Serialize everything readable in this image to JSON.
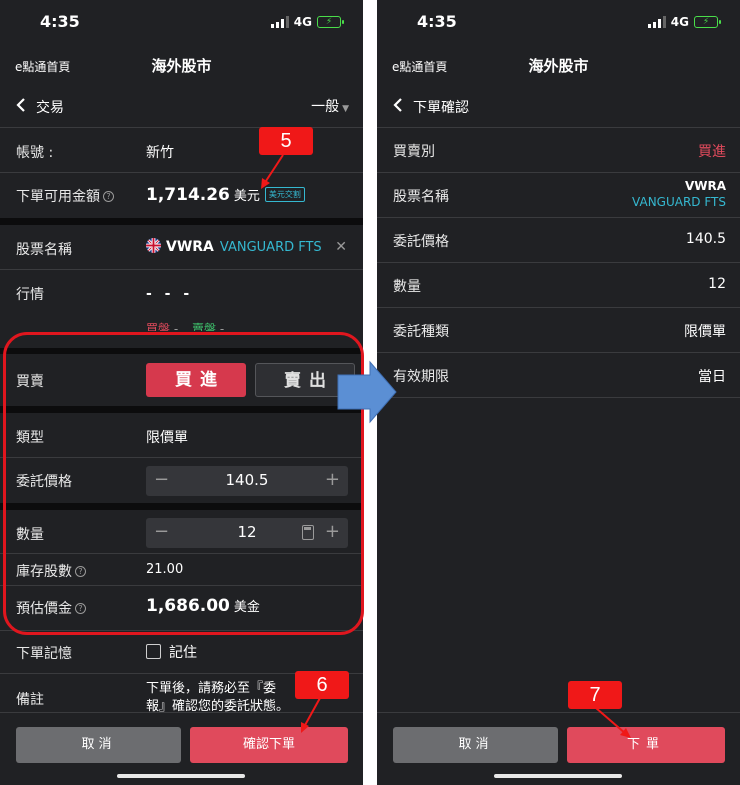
{
  "status_bar": {
    "time": "4:35",
    "network": "4G"
  },
  "app": {
    "home_link": "e點通首頁",
    "title": "海外股市"
  },
  "left": {
    "header": {
      "title": "交易",
      "mode": "一般"
    },
    "account": {
      "label": "帳號 :",
      "value": "新竹"
    },
    "available": {
      "label": "下單可用金額",
      "amount": "1,714.26",
      "unit": "美元",
      "tag": "美元交割"
    },
    "stock": {
      "label": "股票名稱",
      "code": "VWRA",
      "name": "VANGUARD FTS"
    },
    "quote": {
      "label": "行情",
      "value": "- - -",
      "bid": "買盤",
      "ask": "賣盤"
    },
    "side": {
      "label": "買賣",
      "buy": "買進",
      "sell": "賣出"
    },
    "order_type": {
      "label": "類型",
      "value": "限價單"
    },
    "price": {
      "label": "委託價格",
      "value": "140.5"
    },
    "quantity": {
      "label": "數量",
      "value": "12"
    },
    "holdings": {
      "label": "庫存股數",
      "value": "21.00"
    },
    "estimate": {
      "label": "預估價金",
      "amount": "1,686.00",
      "unit": "美金"
    },
    "memory": {
      "label": "下單記憶",
      "checkbox": "記住"
    },
    "note": {
      "label": "備註",
      "line1": "下單後，請務必至『委",
      "line2": "報』確認您的委託狀態。"
    },
    "buttons": {
      "cancel": "取消",
      "confirm": "確認下單"
    }
  },
  "right": {
    "header": {
      "title": "下單確認"
    },
    "rows": [
      {
        "label": "買賣別",
        "value": "買進"
      },
      {
        "label": "股票名稱",
        "value": "VWRA",
        "sub": "VANGUARD FTS"
      },
      {
        "label": "委託價格",
        "value": "140.5"
      },
      {
        "label": "數量",
        "value": "12"
      },
      {
        "label": "委託種類",
        "value": "限價單"
      },
      {
        "label": "有效期限",
        "value": "當日"
      }
    ],
    "buttons": {
      "cancel": "取消",
      "confirm": "下單"
    }
  },
  "annotations": {
    "step5": "5",
    "step6": "6",
    "step7": "7"
  },
  "colors": {
    "background": "#202124",
    "buy_red": "#d6394d",
    "accent_cyan": "#35b8d0",
    "annotation_red": "#f01818",
    "arrow_blue": "#5b8fd4"
  },
  "icons": [
    "back-chevron-icon",
    "caret-down-icon",
    "help-icon",
    "uk-flag-icon",
    "clear-icon",
    "minus-icon",
    "plus-icon",
    "calculator-icon",
    "checkbox-icon",
    "right-arrow-icon"
  ]
}
